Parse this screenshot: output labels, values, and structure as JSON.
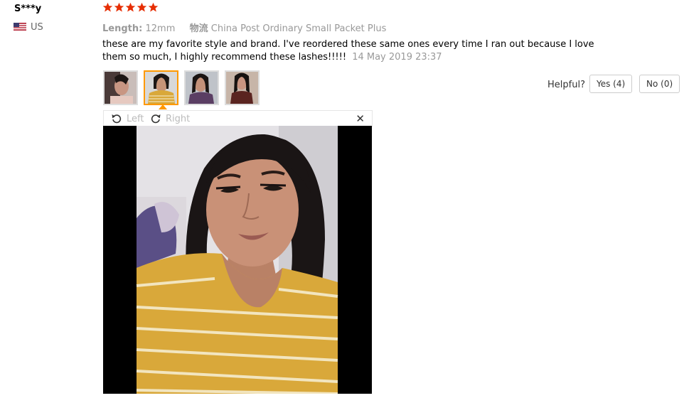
{
  "user": {
    "name": "S***y",
    "country": "US"
  },
  "rating": {
    "stars": 5,
    "max": 5,
    "color": "#e62e04"
  },
  "meta": {
    "length_label": "Length:",
    "length_value": "12mm",
    "logistics_label": "物流",
    "logistics_value": "China Post Ordinary Small Packet Plus"
  },
  "review": {
    "text": "these are my favorite style and brand. I've reordered these same ones every time I ran out because I love them so much, I highly recommend these lashes!!!!!",
    "date": "14 May 2019 23:37"
  },
  "photos": {
    "count": 4,
    "selected_index": 1,
    "accent": "#ff9900"
  },
  "helpful": {
    "label": "Helpful?",
    "yes": "Yes (4)",
    "no": "No (0)"
  },
  "viewer": {
    "left_label": "Left",
    "right_label": "Right",
    "close_label": "✕"
  }
}
